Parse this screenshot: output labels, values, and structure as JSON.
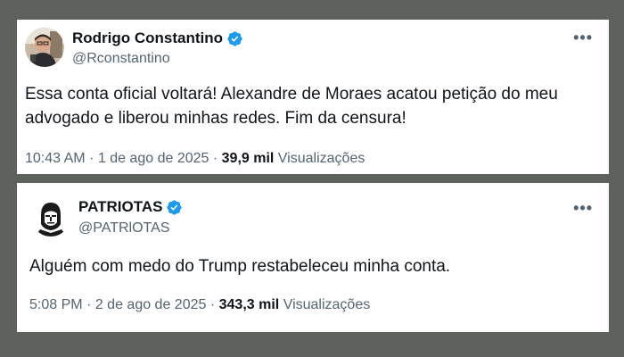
{
  "colors": {
    "background": "#5d625d",
    "card": "#ffffff",
    "verified_blue": "#1d9bf0",
    "secondary_text": "#536471",
    "primary_text": "#0f1419"
  },
  "tweets": [
    {
      "display_name": "Rodrigo Constantino",
      "handle": "@Rconstantino",
      "verified_icon": "verified-badge-icon",
      "more_label": "•••",
      "text": "Essa conta oficial voltará! Alexandre de Moraes acatou petição do meu advogado e liberou minhas redes. Fim da censura!",
      "time": "10:43 AM",
      "separator": "·",
      "date": "1 de ago de 2025",
      "views_count": "39,9 mil",
      "views_label": "Visualizações"
    },
    {
      "display_name": "PATRIOTAS",
      "handle": "@PATRlOTAS",
      "verified_icon": "verified-badge-icon",
      "more_label": "•••",
      "text": "Alguém com medo do Trump restabeleceu minha conta.",
      "time": "5:08 PM",
      "separator": "·",
      "date": "2 de ago de 2025",
      "views_count": "343,3 mil",
      "views_label": "Visualizações"
    }
  ]
}
